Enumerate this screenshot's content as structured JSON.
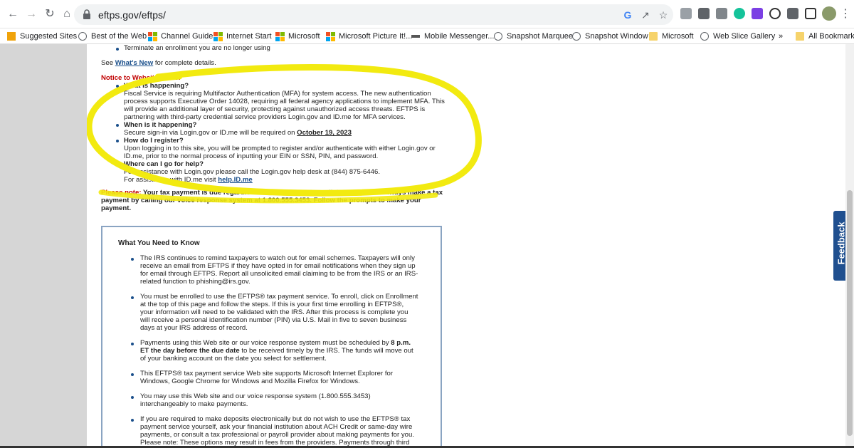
{
  "browser": {
    "url": "eftps.gov/eftps/",
    "bookmarks": [
      "Suggested Sites",
      "Best of the Web",
      "Channel Guide",
      "Internet Start",
      "Microsoft",
      "Microsoft Picture It!...",
      "Mobile Messenger...",
      "Snapshot Marquee",
      "Snapshot Window",
      "Microsoft",
      "Web Slice Gallery"
    ],
    "overflow_label": "»",
    "all_bookmarks": "All Bookmarks"
  },
  "page": {
    "top_bullet": "Terminate an enrollment you are no longer using",
    "see_prefix": "See ",
    "whats_new": "What's New",
    "see_suffix": " for complete details.",
    "notice_heading": "Notice to Website users:",
    "notice": [
      {
        "q": "What is happening?",
        "lines": [
          "Fiscal Service is requiring Multifactor Authentication (MFA) for system access. The new authentication",
          "process supports Executive Order 14028, requiring all federal agency applications to implement MFA. This",
          "will provide an additional layer of security, protecting against unauthorized access threats. EFTPS is",
          "partnering with third-party credential service providers Login.gov and ID.me for MFA services."
        ]
      },
      {
        "q": "When is it happening?",
        "line_prefix": "Secure sign-in via Login.gov or ID.me will be required on ",
        "date": "October 19, 2023"
      },
      {
        "q": "How do I register?",
        "lines": [
          "Upon logging in to this site, you will be prompted to register and/or authenticate with either Login.gov or",
          "ID.me, prior to the normal process of inputting your EIN or SSN, PIN, and password."
        ]
      },
      {
        "q": "Where can I go for help?",
        "line1": "For assistance with Login.gov please call the Login.gov help desk at (844) 875-6446.",
        "line2_prefix": "For assistance with ID.me visit ",
        "line2_link": "help.ID.me"
      }
    ],
    "please_note_label": "Please note:",
    "please_note_lines": [
      " Your tax payment is due regardless of this Web site's availability. You can always make a tax",
      "payment by calling our voice response system at 1.800.555.3453. Follow the prompts to make your",
      "payment."
    ],
    "know_title": "What You Need to Know",
    "know_items": [
      [
        "The IRS continues to remind taxpayers to watch out for email schemes. Taxpayers will only",
        "receive an email from EFTPS if they have opted in for email notifications when they sign up",
        "for email through EFTPS. Report all unsolicited email claiming to be from the IRS or an IRS-",
        "related function to phishing@irs.gov."
      ],
      [
        "You must be enrolled to use the EFTPS® tax payment service. To enroll, click on Enrollment",
        "at the top of this page and follow the steps. If this is your first time enrolling in EFTPS®,",
        "your information will need to be validated with the IRS. After this process is complete you",
        "will receive a personal identification number (PIN) via U.S. Mail in five to seven business",
        "days at your IRS address of record."
      ],
      [
        "Payments using this Web site or our voice response system must be scheduled by ",
        "ET the day before the due date",
        " to be received timely by the IRS. The funds will move out",
        "of your banking account on the date you select for settlement."
      ],
      [
        "This EFTPS® tax payment service Web site supports Microsoft Internet Explorer for",
        "Windows, Google Chrome for Windows and Mozilla Firefox for Windows."
      ],
      [
        "You may use this Web site and our voice response system (1.800.555.3453)",
        "interchangeably to make payments."
      ],
      [
        "If you are required to make deposits electronically but do not wish to use the EFTPS® tax",
        "payment service yourself, ask your financial institution about ACH Credit or same-day wire",
        "payments, or consult a tax professional or payroll provider about making payments for you.",
        "Please note: These options may result in fees from the providers. Payments through third"
      ]
    ],
    "deadline_time": "8 p.m.",
    "feedback": "Feedback"
  }
}
